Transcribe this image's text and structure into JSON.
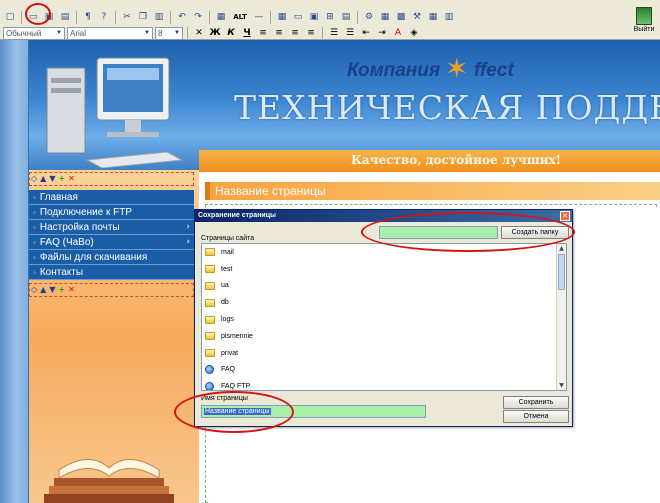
{
  "toolbar": {
    "style_select": "Обычный",
    "font_select": "Arial",
    "size_select": "8",
    "alt_label": "ALT",
    "bold_label": "Ж",
    "italic_label": "К",
    "underline_label": "Ч",
    "exit_label": "Выйти"
  },
  "header": {
    "company_name": "Компания",
    "company_brand": "ffect",
    "title": "ТЕХНИЧЕСКАЯ ПОДДЕРЖКА",
    "slogan": "Качество, достойное лучших!"
  },
  "sidebar": {
    "items": [
      {
        "label": "Главная",
        "has_arrow": false
      },
      {
        "label": "Подключение к FTP",
        "has_arrow": false
      },
      {
        "label": "Настройка почты",
        "has_arrow": true
      },
      {
        "label": "FAQ (ЧаВо)",
        "has_arrow": true
      },
      {
        "label": "Файлы для скачивания",
        "has_arrow": false
      },
      {
        "label": "Контакты",
        "has_arrow": false
      }
    ]
  },
  "content": {
    "page_title": "Название страницы"
  },
  "dialog": {
    "title": "Сохранение страницы",
    "create_folder_button": "Создать папку",
    "folder_input_value": "",
    "sites_label": "Страницы сайта",
    "files": [
      {
        "name": "mail",
        "type": "folder"
      },
      {
        "name": "test",
        "type": "folder"
      },
      {
        "name": "ua",
        "type": "folder"
      },
      {
        "name": "db",
        "type": "folder"
      },
      {
        "name": "logs",
        "type": "folder"
      },
      {
        "name": "pismennie",
        "type": "folder"
      },
      {
        "name": "privat",
        "type": "folder"
      },
      {
        "name": "FAQ",
        "type": "page"
      },
      {
        "name": "FAQ FTP",
        "type": "page"
      }
    ],
    "name_label": "Имя страницы",
    "name_value": "Название страницы",
    "save_button": "Сохранить",
    "cancel_button": "Отмена"
  },
  "colors": {
    "annotation": "#d71414",
    "menu_blue": "#1b5ea8",
    "accent_orange": "#f08e1e",
    "input_green": "#a8f0a8"
  }
}
